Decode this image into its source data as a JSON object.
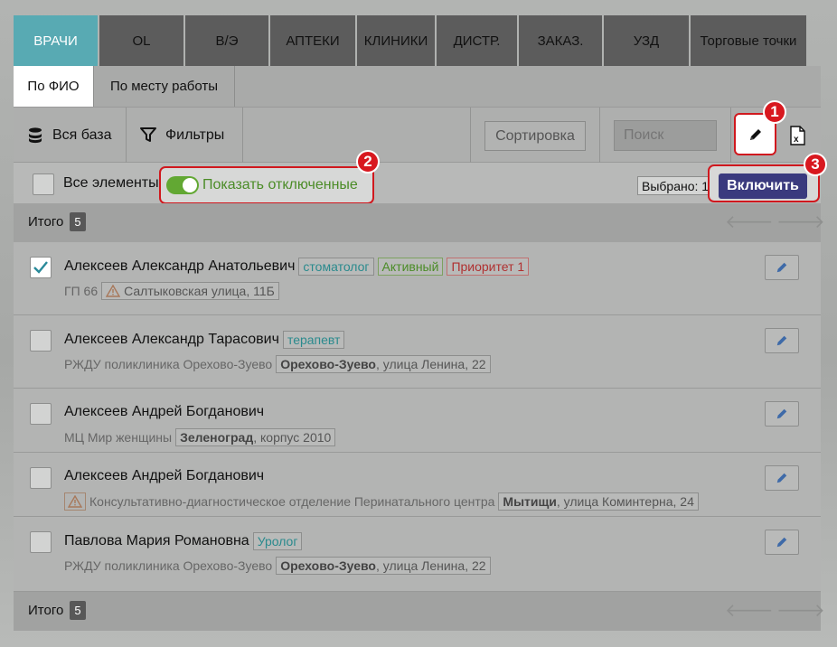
{
  "tabs": [
    "ВРАЧИ",
    "OL",
    "В/Э",
    "АПТЕКИ",
    "КЛИНИКИ",
    "ДИСТР.",
    "ЗАКАЗ.",
    "УЗД",
    "Торговые точки"
  ],
  "subtabs": [
    "По ФИО",
    "По месту работы"
  ],
  "toolbar": {
    "all_base": "Вся база",
    "filters": "Фильтры",
    "sort": "Сортировка",
    "search_placeholder": "Поиск"
  },
  "selection": {
    "all_items": "Все элементы",
    "show_disabled": "Показать отключенные",
    "selected": "Выбрано: 1",
    "enable": "Включить"
  },
  "badges": [
    "1",
    "2",
    "3"
  ],
  "total": {
    "label": "Итого",
    "count": "5"
  },
  "doctors": [
    {
      "name": "Алексеев Александр Анатольевич",
      "checked": true,
      "specialty": "стоматолог",
      "status": "Активный",
      "priority": "Приоритет 1",
      "org": "ГП 66",
      "warn": true,
      "city": "",
      "address": "Салтыковская улица, 11Б"
    },
    {
      "name": "Алексеев Александр Тарасович",
      "checked": false,
      "specialty": "терапевт",
      "status": "",
      "priority": "",
      "org": "РЖДУ поликлиника Орехово-Зуево",
      "warn": false,
      "city": "Орехово-Зуево",
      "address": ", улица Ленина, 22"
    },
    {
      "name": "Алексеев Андрей Богданович",
      "checked": false,
      "specialty": "",
      "status": "",
      "priority": "",
      "org": "МЦ Мир женщины",
      "warn": false,
      "city": "Зеленоград",
      "address": ", корпус 2010"
    },
    {
      "name": "Алексеев Андрей Богданович",
      "checked": false,
      "specialty": "",
      "status": "",
      "priority": "",
      "org": "Консультативно-диагностическое отделение Перинатального центра",
      "warn": true,
      "city": "Мытищи",
      "address": ", улица Коминтерна, 24"
    },
    {
      "name": "Павлова Мария Романовна",
      "checked": false,
      "specialty": "Уролог",
      "status": "",
      "priority": "",
      "org": "РЖДУ поликлиника Орехово-Зуево",
      "warn": false,
      "city": "Орехово-Зуево",
      "address": ", улица Ленина, 22"
    }
  ]
}
